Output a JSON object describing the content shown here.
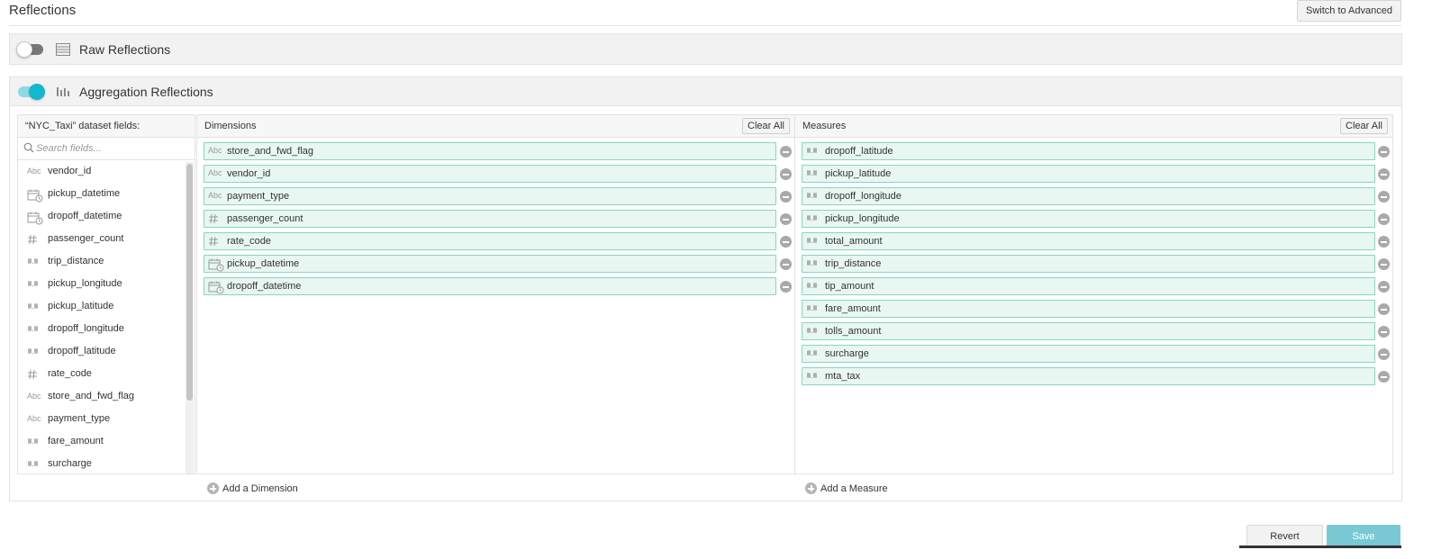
{
  "header": {
    "title": "Reflections",
    "switch_label": "Switch to Advanced"
  },
  "raw": {
    "label": "Raw Reflections",
    "enabled": false,
    "icon": "table-rows-icon"
  },
  "aggregation": {
    "label": "Aggregation Reflections",
    "enabled": true,
    "icon": "bar-chart-icon",
    "accent_color": "#13b8cf"
  },
  "fields": {
    "header": "“NYC_Taxi” dataset fields:",
    "search_placeholder": "Search fields...",
    "items": [
      {
        "name": "vendor_id",
        "type": "text"
      },
      {
        "name": "pickup_datetime",
        "type": "datetime"
      },
      {
        "name": "dropoff_datetime",
        "type": "datetime"
      },
      {
        "name": "passenger_count",
        "type": "integer"
      },
      {
        "name": "trip_distance",
        "type": "decimal"
      },
      {
        "name": "pickup_longitude",
        "type": "decimal"
      },
      {
        "name": "pickup_latitude",
        "type": "decimal"
      },
      {
        "name": "dropoff_longitude",
        "type": "decimal"
      },
      {
        "name": "dropoff_latitude",
        "type": "decimal"
      },
      {
        "name": "rate_code",
        "type": "integer"
      },
      {
        "name": "store_and_fwd_flag",
        "type": "text"
      },
      {
        "name": "payment_type",
        "type": "text"
      },
      {
        "name": "fare_amount",
        "type": "decimal"
      },
      {
        "name": "surcharge",
        "type": "decimal"
      }
    ]
  },
  "dimensions": {
    "title": "Dimensions",
    "clear_label": "Clear All",
    "add_label": "Add a Dimension",
    "items": [
      {
        "name": "store_and_fwd_flag",
        "type": "text"
      },
      {
        "name": "vendor_id",
        "type": "text"
      },
      {
        "name": "payment_type",
        "type": "text"
      },
      {
        "name": "passenger_count",
        "type": "integer"
      },
      {
        "name": "rate_code",
        "type": "integer"
      },
      {
        "name": "pickup_datetime",
        "type": "datetime"
      },
      {
        "name": "dropoff_datetime",
        "type": "datetime"
      }
    ]
  },
  "measures": {
    "title": "Measures",
    "clear_label": "Clear All",
    "add_label": "Add a Measure",
    "items": [
      {
        "name": "dropoff_latitude",
        "type": "decimal"
      },
      {
        "name": "pickup_latitude",
        "type": "decimal"
      },
      {
        "name": "dropoff_longitude",
        "type": "decimal"
      },
      {
        "name": "pickup_longitude",
        "type": "decimal"
      },
      {
        "name": "total_amount",
        "type": "decimal"
      },
      {
        "name": "trip_distance",
        "type": "decimal"
      },
      {
        "name": "tip_amount",
        "type": "decimal"
      },
      {
        "name": "fare_amount",
        "type": "decimal"
      },
      {
        "name": "tolls_amount",
        "type": "decimal"
      },
      {
        "name": "surcharge",
        "type": "decimal"
      },
      {
        "name": "mta_tax",
        "type": "decimal"
      }
    ]
  },
  "footer": {
    "revert_label": "Revert",
    "save_label": "Save"
  },
  "type_labels": {
    "text": "Abc"
  }
}
